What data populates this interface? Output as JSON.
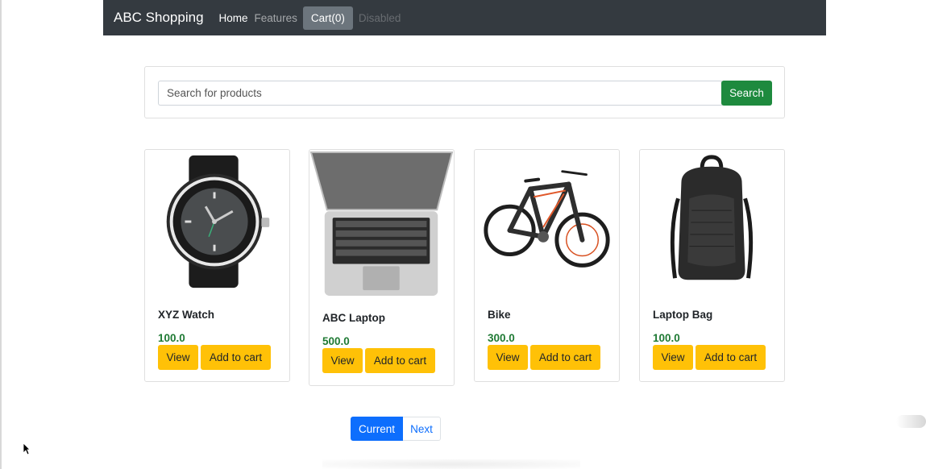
{
  "navbar": {
    "brand": "ABC Shopping",
    "links": {
      "home": "Home",
      "features": "Features",
      "cart": "Cart(0)",
      "disabled": "Disabled"
    }
  },
  "search": {
    "placeholder": "Search for products",
    "value": "",
    "button_label": "Search"
  },
  "products": [
    {
      "title": "XYZ Watch",
      "price": "100.0",
      "view_label": "View",
      "add_label": "Add to cart",
      "image": "watch-image"
    },
    {
      "title": "ABC Laptop",
      "price": "500.0",
      "view_label": "View",
      "add_label": "Add to cart",
      "image": "laptop-image"
    },
    {
      "title": "Bike",
      "price": "300.0",
      "view_label": "View",
      "add_label": "Add to cart",
      "image": "bike-image"
    },
    {
      "title": "Laptop Bag",
      "price": "100.0",
      "view_label": "View",
      "add_label": "Add to cart",
      "image": "backpack-image"
    }
  ],
  "pagination": {
    "current": "Current",
    "next": "Next"
  },
  "colors": {
    "navbar_bg": "#343a40",
    "search_button": "#1e8a3e",
    "price": "#1f7a34",
    "action_button": "#ffc107",
    "primary": "#0d6efd"
  }
}
